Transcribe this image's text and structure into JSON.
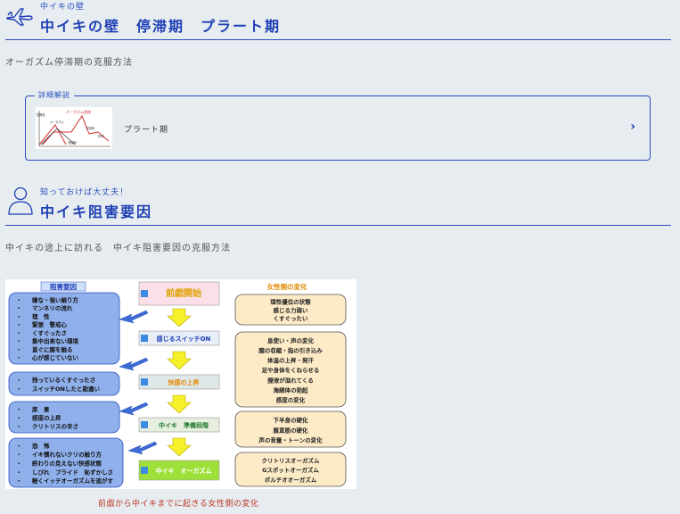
{
  "section1": {
    "subtitle": "中イキの壁",
    "title": "中イキの壁　停滞期　プラート期",
    "lead": "オーガズム停滞期の克服方法",
    "icon": "airplane-icon",
    "card": {
      "legend": "詳細解説",
      "text": "プラート期",
      "thumb_title": "オーガズム曲線",
      "thumb_labels": [
        "性興奮",
        "オーガズム",
        "平坦期",
        "停滞",
        "消退期"
      ],
      "chevron": "chevron-right-icon"
    }
  },
  "section2": {
    "subtitle": "知っておけば大丈夫！",
    "title": "中イキ阻害要因",
    "lead": "中イキの途上に訪れる　中イキ阻害要因の克服方法",
    "icon": "user-icon"
  },
  "diagram": {
    "left_header": "阻害要因",
    "right_header": "女性側の変化",
    "left_boxes": [
      [
        "嫌な・強い触り方",
        "マンネリの流れ",
        "理　性",
        "緊張　警戒心",
        "くすぐったさ",
        "集中出来ない環境",
        "直ぐに膣を触る",
        "心が感じていない"
      ],
      [
        "残っているくすぐったさ",
        "スイッチONしたと勘違い"
      ],
      [
        "尿　意",
        "感度の上昇",
        "クリトリスの辛さ"
      ],
      [
        "恐　怖",
        "イキ慣れないクリの触り方",
        "終わりの見えない快感状態",
        "しびれ　プライド　恥ずかしさ",
        "軽くイッテオーガズムを逃がす"
      ]
    ],
    "center_steps": [
      "前戯開始",
      "感じるスイッチON",
      "快感の上昇",
      "中イキ　準備段階",
      "中イキ　オーガズム"
    ],
    "right_boxes": [
      [
        "理性優位の状態",
        "感じる力弱い",
        "くすぐったい"
      ],
      [
        "息使い・声の変化",
        "膣の収縮・指の引き込み",
        "体温の上昇・発汗",
        "足や身体をくねらせる",
        "膣液が溢れてくる",
        "海綿体の勃起",
        "感度の変化"
      ],
      [
        "下半身の硬化",
        "腹直筋の硬化",
        "声の音量・トーンの変化"
      ],
      [
        "クリトリスオーガズム",
        "Gスポットオーガズム",
        "ポルチオオーガズム"
      ]
    ]
  },
  "caption": "前戯から中イキまでに起きる女性側の変化",
  "colors": {
    "accent": "#1e3fb5",
    "left_box": "#8fb0ea",
    "right_box": "#fdebc8",
    "arrow_yellow": "#f5f02a",
    "caption": "#c0392b"
  }
}
